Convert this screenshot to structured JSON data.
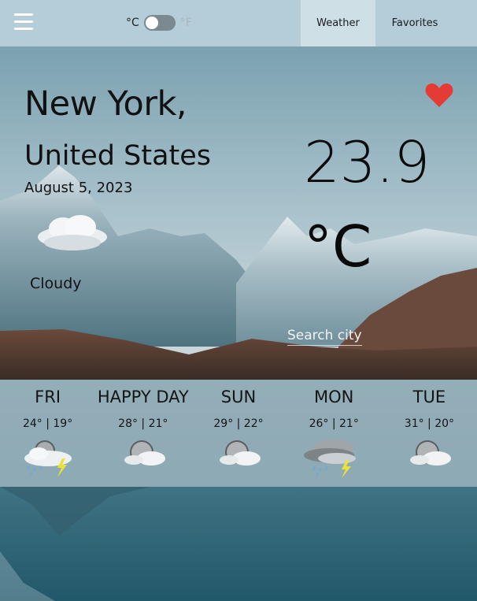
{
  "header": {
    "menu_icon": "hamburger-menu-icon",
    "unit_celsius": "°C",
    "unit_fahrenheit": "°F",
    "nav": [
      {
        "label": "Weather",
        "active": true
      },
      {
        "label": "Favorites",
        "active": false
      }
    ]
  },
  "current": {
    "city": "New York,",
    "country": "United States",
    "date": "August 5, 2023",
    "condition": "Cloudy",
    "condition_icon": "cloud-icon",
    "temperature": "23.9",
    "unit": "°C",
    "favorite_icon": "heart-icon",
    "favorite_color": "#e53b35"
  },
  "search": {
    "label": "Search city"
  },
  "forecast": [
    {
      "day": "FRI",
      "temps": "24° | 19°",
      "icon": "moon-storm-icon"
    },
    {
      "day": "HAPPY DAY",
      "temps": "28° | 21°",
      "icon": "moon-cloud-icon"
    },
    {
      "day": "SUN",
      "temps": "29° | 22°",
      "icon": "moon-cloud-icon"
    },
    {
      "day": "MON",
      "temps": "26° | 21°",
      "icon": "cloud-storm-icon"
    },
    {
      "day": "TUE",
      "temps": "31° | 20°",
      "icon": "moon-cloud-icon"
    }
  ]
}
